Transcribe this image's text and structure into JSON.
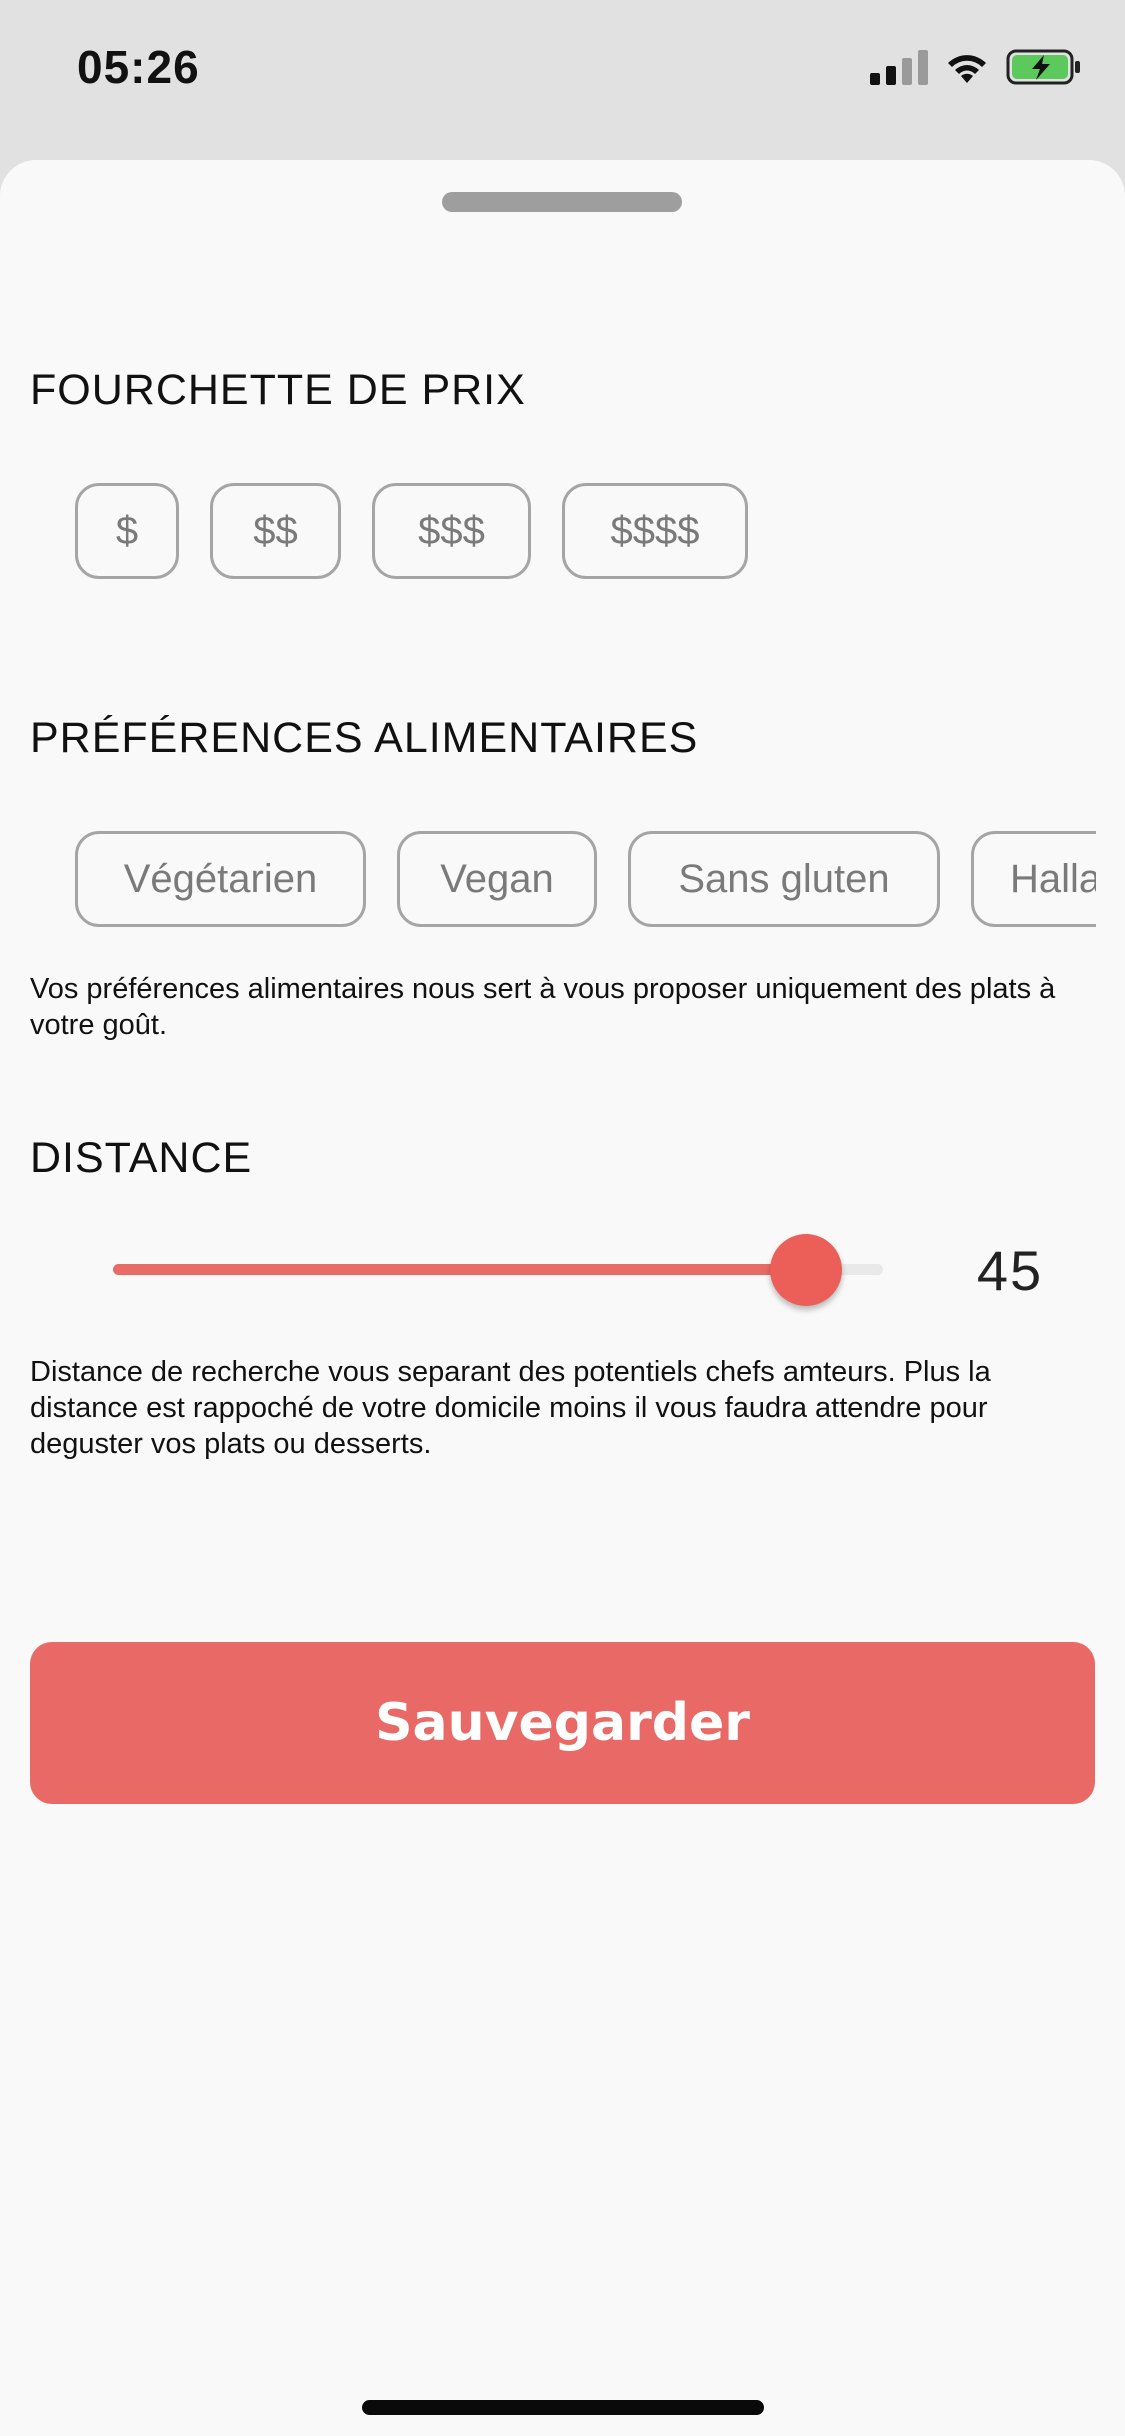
{
  "status_bar": {
    "time": "05:26",
    "colors": {
      "battery_fill": "#5cc95c"
    }
  },
  "price": {
    "title": "FOURCHETTE DE PRIX",
    "options": [
      "$",
      "$$",
      "$$$",
      "$$$$"
    ]
  },
  "diet": {
    "title": "PRÉFÉRENCES ALIMENTAIRES",
    "options": [
      "Végétarien",
      "Vegan",
      "Sans gluten",
      "Hallal"
    ],
    "description": "Vos préférences alimentaires nous sert à vous proposer uniquement des plats à votre goût."
  },
  "distance": {
    "title": "DISTANCE",
    "value": "45",
    "slider_fraction": 0.9,
    "description": "Distance de recherche vous separant des potentiels chefs amteurs. Plus la distance est rappoché de votre domicile moins il vous faudra attendre pour deguster vos plats ou desserts."
  },
  "actions": {
    "save_label": "Sauvegarder"
  },
  "colors": {
    "accent": "#e86966",
    "chip_border": "#a5a5a5",
    "sheet_bg": "#f9f9f9",
    "backdrop": "#e1e1e1"
  }
}
